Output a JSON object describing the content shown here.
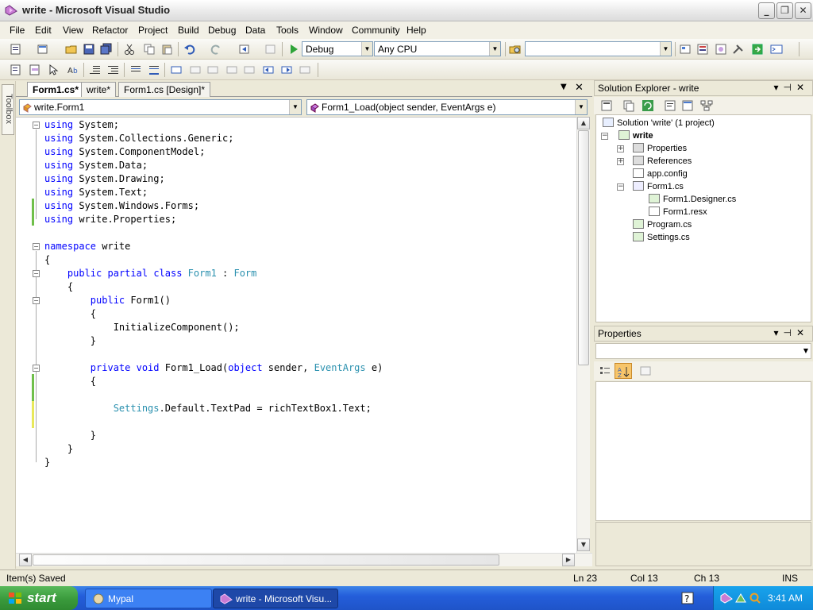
{
  "window": {
    "title": "write - Microsoft Visual Studio"
  },
  "menu": [
    "File",
    "Edit",
    "View",
    "Refactor",
    "Project",
    "Build",
    "Debug",
    "Data",
    "Tools",
    "Window",
    "Community",
    "Help"
  ],
  "toolbar": {
    "config": "Debug",
    "platform": "Any CPU",
    "find": ""
  },
  "toolbox": {
    "label": "Toolbox"
  },
  "editor": {
    "tabs": [
      {
        "label": "Form1.cs*",
        "active": true
      },
      {
        "label": "write*",
        "active": false
      },
      {
        "label": "Form1.cs [Design]*",
        "active": false
      }
    ],
    "class_combo": "write.Form1",
    "member_combo": "Form1_Load(object sender, EventArgs e)",
    "code_lines": [
      "using System;",
      "using System.Collections.Generic;",
      "using System.ComponentModel;",
      "using System.Data;",
      "using System.Drawing;",
      "using System.Text;",
      "using System.Windows.Forms;",
      "using write.Properties;",
      "",
      "namespace write",
      "{",
      "    public partial class Form1 : Form",
      "    {",
      "        public Form1()",
      "        {",
      "            InitializeComponent();",
      "        }",
      "",
      "        private void Form1_Load(object sender, EventArgs e)",
      "        {",
      "",
      "            Settings.Default.TextPad = richTextBox1.Text;",
      "",
      "        }",
      "    }",
      "}"
    ]
  },
  "solution_explorer": {
    "header": "Solution Explorer - write",
    "solution": "Solution 'write' (1 project)",
    "project": "write",
    "items": [
      "Properties",
      "References",
      "app.config",
      "Form1.cs",
      "Form1.Designer.cs",
      "Form1.resx",
      "Program.cs",
      "Settings.cs"
    ]
  },
  "properties": {
    "header": "Properties"
  },
  "status": {
    "message": "Item(s) Saved",
    "ln": "Ln 23",
    "col": "Col 13",
    "ch": "Ch 13",
    "mode": "INS"
  },
  "taskbar": {
    "start": "start",
    "tasks": [
      "Mypal",
      "write - Microsoft Visu..."
    ],
    "clock": "3:41 AM"
  },
  "colors": {
    "keyword": "#0000ff",
    "type": "#2b91af",
    "change_saved": "#6fbf4a",
    "change_unsaved": "#e8e85a"
  }
}
